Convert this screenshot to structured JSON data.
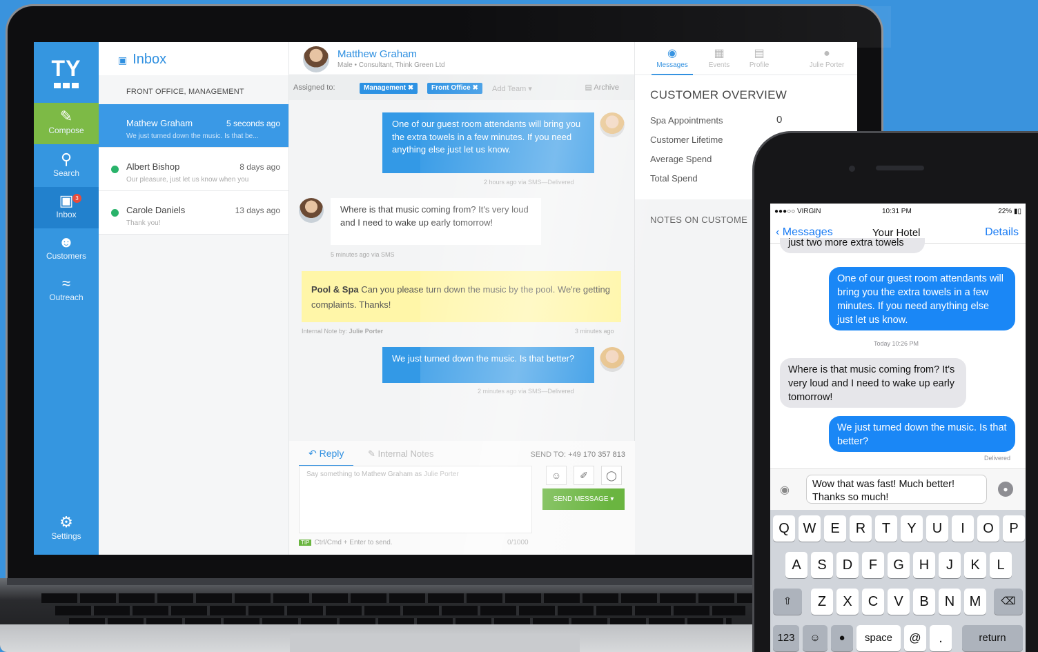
{
  "nav": {
    "logo": "TY",
    "items": [
      {
        "label": "Compose",
        "icon": "pencil-icon"
      },
      {
        "label": "Search",
        "icon": "search-icon"
      },
      {
        "label": "Inbox",
        "icon": "inbox-icon",
        "badge": "3"
      },
      {
        "label": "Customers",
        "icon": "customers-icon"
      },
      {
        "label": "Outreach",
        "icon": "wifi-icon"
      },
      {
        "label": "Settings",
        "icon": "gear-icon"
      }
    ]
  },
  "inbox": {
    "title": "Inbox",
    "group": "FRONT OFFICE, MANAGEMENT",
    "conversations": [
      {
        "name": "Mathew Graham",
        "time": "5 seconds ago",
        "preview": "We just turned down the music. Is that be..."
      },
      {
        "name": "Albert Bishop",
        "time": "8 days ago",
        "preview": "Our pleasure, just let us know when you"
      },
      {
        "name": "Carole Daniels",
        "time": "13 days ago",
        "preview": "Thank you!"
      }
    ]
  },
  "chat": {
    "contact_name": "Matthew Graham",
    "contact_sub": "Male • Consultant, Think Green Ltd",
    "assigned_label": "Assigned to:",
    "tags": [
      "Management ✖",
      "Front Office ✖"
    ],
    "add_team": "Add Team ▾",
    "archive": "Archive",
    "messages": [
      {
        "text": "One of our guest room attendants will bring you the extra towels in a few minutes. If you need anything else just let us know.",
        "meta": "2 hours ago via SMS—Delivered"
      },
      {
        "text": "Where is that music coming from? It's very loud and I need to wake up early tomorrow!",
        "meta": "5 minutes ago via SMS"
      },
      {
        "text": "We just turned down the music. Is that better?",
        "meta": "2 minutes ago via SMS—Delivered"
      }
    ],
    "note": {
      "author_tag": "Pool & Spa",
      "text": "Can you please turn down the music by the pool. We're getting complaints. Thanks!",
      "meta_left": "Internal Note by:",
      "meta_author": "Julie Porter",
      "meta_right": "3 minutes ago"
    },
    "reply": {
      "tab_reply": "Reply",
      "tab_notes": "Internal Notes",
      "send_to": "SEND TO: +49 170 357 813",
      "placeholder": "Say something to Mathew Graham as Julie Porter",
      "send_button": "SEND MESSAGE ▾",
      "tip_badge": "TIP",
      "tip": "Ctrl/Cmd + Enter to send.",
      "count": "0/1000"
    }
  },
  "overview": {
    "tabs": [
      "Messages",
      "Events",
      "Profile",
      "Julie Porter"
    ],
    "title": "CUSTOMER OVERVIEW",
    "rows": [
      {
        "label": "Spa Appointments",
        "value": "0"
      },
      {
        "label": "Customer Lifetime",
        "value": ""
      },
      {
        "label": "Average Spend",
        "value": ""
      },
      {
        "label": "Total Spend",
        "value": ""
      }
    ],
    "notes_title": "NOTES ON CUSTOME"
  },
  "phone": {
    "carrier": "●●●○○ VIRGIN",
    "time": "10:31 PM",
    "battery": "22%",
    "back": "Messages",
    "title": "Your Hotel",
    "details": "Details",
    "cut_message": "just two more extra towels",
    "msg_out_1": "One of our guest room attendants will bring you the extra towels in a few minutes. If you need anything else just let us know.",
    "timestamp": "Today 10:26 PM",
    "msg_in_1": "Where is that music coming from? It's very loud and I need to wake up early tomorrow!",
    "msg_out_2": "We just turned down the music. Is that better?",
    "delivered": "Delivered",
    "draft": "Wow that was fast! Much better! Thanks so much!",
    "keys_row1": [
      "Q",
      "W",
      "E",
      "R",
      "T",
      "Y",
      "U",
      "I",
      "O",
      "P"
    ],
    "keys_row2": [
      "A",
      "S",
      "D",
      "F",
      "G",
      "H",
      "J",
      "K",
      "L"
    ],
    "keys_row3": [
      "Z",
      "X",
      "C",
      "V",
      "B",
      "N",
      "M"
    ],
    "key_123": "123",
    "key_space": "space",
    "key_at": "@",
    "key_dot": ".",
    "key_return": "return"
  },
  "colors": {
    "background": "#3a93dd",
    "accent": "#3596e0",
    "compose": "#7dba46",
    "note": "#fff6a8"
  }
}
